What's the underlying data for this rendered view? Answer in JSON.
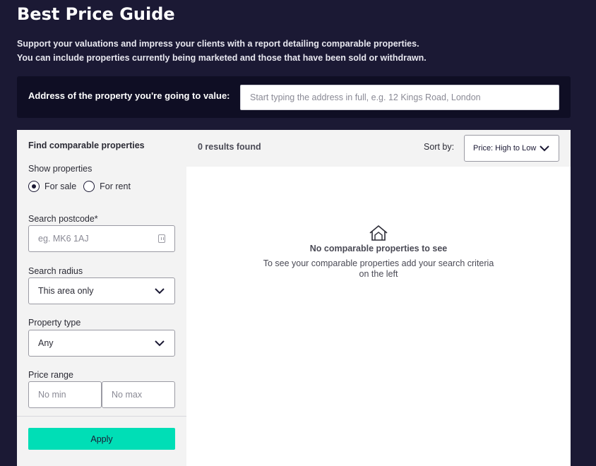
{
  "page": {
    "title": "Best Price Guide",
    "intro_line1": "Support your valuations and impress your clients with a report detailing comparable properties.",
    "intro_line2": "You can include properties currently being marketed and those that have been sold or withdrawn."
  },
  "address": {
    "label": "Address of the property you're going to value:",
    "placeholder": "Start typing the address in full, e.g. 12 Kings Road, London"
  },
  "sidebar": {
    "title": "Find comparable properties",
    "show_properties_label": "Show properties",
    "for_sale": "For sale",
    "for_rent": "For rent",
    "selected": "For sale",
    "postcode_label": "Search postcode*",
    "postcode_placeholder": "eg. MK6 1AJ",
    "radius_label": "Search radius",
    "radius_value": "This area only",
    "type_label": "Property type",
    "type_value": "Any",
    "price_label": "Price range",
    "min_placeholder": "No min",
    "max_placeholder": "No max",
    "apply_label": "Apply"
  },
  "results": {
    "count_text": "0 results found",
    "sort_label": "Sort by:",
    "sort_value": "Price: High to Low",
    "empty_title": "No comparable properties to see",
    "empty_text": "To see your comparable properties add your search criteria on the left"
  },
  "colors": {
    "background": "#1b1934",
    "address_bar": "#0f0e24",
    "accent": "#00deb6",
    "panel": "#f3f3f3"
  },
  "icons": {
    "house": "house-icon",
    "chevron": "chevron-down-icon",
    "keyboard": "keyboard-icon"
  }
}
